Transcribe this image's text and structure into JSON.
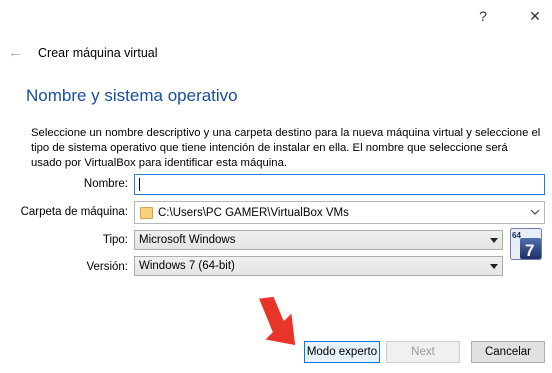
{
  "window": {
    "help_glyph": "?",
    "close_glyph": "✕"
  },
  "header": {
    "back_glyph": "←",
    "title": "Crear máquina virtual"
  },
  "section": {
    "title": "Nombre y sistema operativo",
    "description": "Seleccione un nombre descriptivo y una carpeta destino para la nueva máquina virtual y seleccione el tipo de sistema operativo que tiene intención de instalar en ella. El nombre que seleccione será usado por VirtualBox para identificar esta máquina."
  },
  "form": {
    "name_label": "Nombre:",
    "name_value": "",
    "folder_label": "Carpeta de máquina:",
    "folder_value": "C:\\Users\\PC GAMER\\VirtualBox VMs",
    "type_label": "Tipo:",
    "type_value": "Microsoft Windows",
    "version_label": "Versión:",
    "version_value": "Windows 7 (64-bit)"
  },
  "os_badge": {
    "bits": "64",
    "version": "7",
    "icon": "windows-7-64bit-icon"
  },
  "buttons": {
    "expert": "Modo experto",
    "next": "Next",
    "cancel": "Cancelar"
  },
  "colors": {
    "section_title": "#1a4fa0",
    "focus_border": "#2a7ad6",
    "annotation_arrow": "#e8352a"
  }
}
